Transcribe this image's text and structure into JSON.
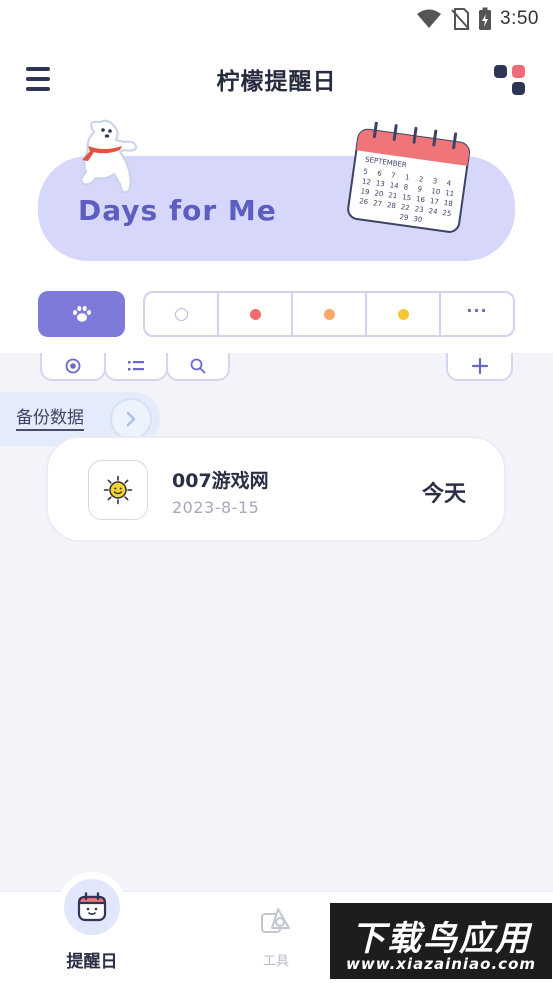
{
  "status_bar": {
    "time": "3:50"
  },
  "header": {
    "title": "柠檬提醒日"
  },
  "banner": {
    "text": "Days for Me",
    "calendar_month": "SEPTEMBER",
    "calendar_rows": [
      [
        "5",
        "6",
        "7",
        "1",
        "2",
        "3",
        "4"
      ],
      [
        "12",
        "13",
        "14",
        "8",
        "9",
        "10",
        "11"
      ],
      [
        "19",
        "20",
        "21",
        "15",
        "16",
        "17",
        "18"
      ],
      [
        "26",
        "27",
        "28",
        "22",
        "23",
        "24",
        "25"
      ],
      [
        "",
        "",
        "",
        "29",
        "30",
        "",
        ""
      ]
    ]
  },
  "filters": {
    "colors": [
      "#ffffff",
      "#f06b6b",
      "#f7a96b",
      "#f5c634"
    ],
    "more": "···"
  },
  "backup": {
    "label": "备份数据"
  },
  "events": [
    {
      "title": "007游戏网",
      "date": "2023-8-15",
      "days": "今天",
      "icon": "sun-face-icon"
    }
  ],
  "bottom_nav": {
    "items": [
      {
        "label": "提醒日",
        "icon": "calendar-face-icon",
        "active": true
      },
      {
        "label": "工具",
        "icon": "tools-icon",
        "active": false
      }
    ]
  },
  "watermark": {
    "main": "下载鸟应用",
    "sub": "www.xiazainiao.com"
  },
  "colors": {
    "accent": "#7d7ad9",
    "banner_bg": "#d7d6fb",
    "banner_text": "#5c5fbf"
  }
}
